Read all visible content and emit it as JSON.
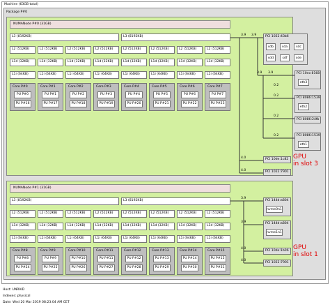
{
  "machine": {
    "label": "Machine (63GB total)"
  },
  "package": {
    "label": "Package P#0"
  },
  "numa0": {
    "label": "NUMANode P#0 (31GB)",
    "l3": [
      "L3 (8192KB)",
      "L3 (8192KB)"
    ],
    "l2": "L2 (512KB)",
    "l1d": "L1d (32KB)",
    "l1i": "L1i (64KB)",
    "cores": [
      {
        "core": "Core P#0",
        "pus": [
          "PU P#0",
          "PU P#16"
        ]
      },
      {
        "core": "Core P#1",
        "pus": [
          "PU P#1",
          "PU P#17"
        ]
      },
      {
        "core": "Core P#2",
        "pus": [
          "PU P#2",
          "PU P#18"
        ]
      },
      {
        "core": "Core P#3",
        "pus": [
          "PU P#3",
          "PU P#19"
        ]
      },
      {
        "core": "Core P#4",
        "pus": [
          "PU P#4",
          "PU P#20"
        ]
      },
      {
        "core": "Core P#5",
        "pus": [
          "PU P#5",
          "PU P#21"
        ]
      },
      {
        "core": "Core P#6",
        "pus": [
          "PU P#6",
          "PU P#22"
        ]
      },
      {
        "core": "Core P#7",
        "pus": [
          "PU P#7",
          "PU P#23"
        ]
      }
    ]
  },
  "numa1": {
    "label": "NUMANode P#1 (31GB)",
    "l3": [
      "L3 (8192KB)",
      "L3 (8192KB)"
    ],
    "l2": "L2 (512KB)",
    "l1d": "L1d (32KB)",
    "l1i": "L1i (64KB)",
    "cores": [
      {
        "core": "Core P#8",
        "pus": [
          "PU P#8",
          "PU P#24"
        ]
      },
      {
        "core": "Core P#9",
        "pus": [
          "PU P#9",
          "PU P#25"
        ]
      },
      {
        "core": "Core P#10",
        "pus": [
          "PU P#10",
          "PU P#26"
        ]
      },
      {
        "core": "Core P#11",
        "pus": [
          "PU P#11",
          "PU P#27"
        ]
      },
      {
        "core": "Core P#12",
        "pus": [
          "PU P#12",
          "PU P#28"
        ]
      },
      {
        "core": "Core P#13",
        "pus": [
          "PU P#13",
          "PU P#29"
        ]
      },
      {
        "core": "Core P#14",
        "pus": [
          "PU P#14",
          "PU P#30"
        ]
      },
      {
        "core": "Core P#15",
        "pus": [
          "PU P#15",
          "PU P#31"
        ]
      }
    ]
  },
  "pci0": {
    "bw": [
      "3.9",
      "3.9",
      "3.9",
      "3.9",
      "0.2",
      "0.2",
      "0.2",
      "0.2",
      "4.0",
      "4.0"
    ],
    "sata": {
      "label": "PCI 1022:43b6",
      "devices": [
        "sdb",
        "sda",
        "sdc",
        "sdd",
        "sdf",
        "sde"
      ]
    },
    "eth3": {
      "label": "PCI 10ec:8168",
      "dev": "eth3"
    },
    "intel1": {
      "label": "PCI 8086:1539",
      "dev": "eth2"
    },
    "wifi": {
      "label": "PCI 8086:24fb",
      "dev": ""
    },
    "intel2": {
      "label": "PCI 8086:1539",
      "dev": "eth1"
    },
    "gpu": {
      "label": "PCI 10de:1c82"
    },
    "audio": {
      "label": "PCI 1022:7901"
    },
    "annotation": [
      "GPU",
      "in slot 3"
    ]
  },
  "pci1": {
    "bw": [
      "3.9",
      "3.9",
      "4.0",
      "4.0"
    ],
    "nvme0": {
      "label": "PCI 144d:a804",
      "dev": "nvme0n1"
    },
    "nvme1": {
      "label": "PCI 144d:a804",
      "dev": "nvme1n1"
    },
    "gpu": {
      "label": "PCI 10de:1b06"
    },
    "audio": {
      "label": "PCI 1022:7901"
    },
    "annotation": [
      "GPU",
      "in slot 1"
    ]
  },
  "footer": {
    "host": "Host: UNRAID",
    "indexes": "Indexes: physical",
    "date": "Date: Wed 20 Mar 2019 08:23:04 AM CET"
  },
  "colors": {
    "numa": "#d3f0a0",
    "package": "#dedede",
    "core": "#bebebe",
    "annotation": "#e00000"
  }
}
